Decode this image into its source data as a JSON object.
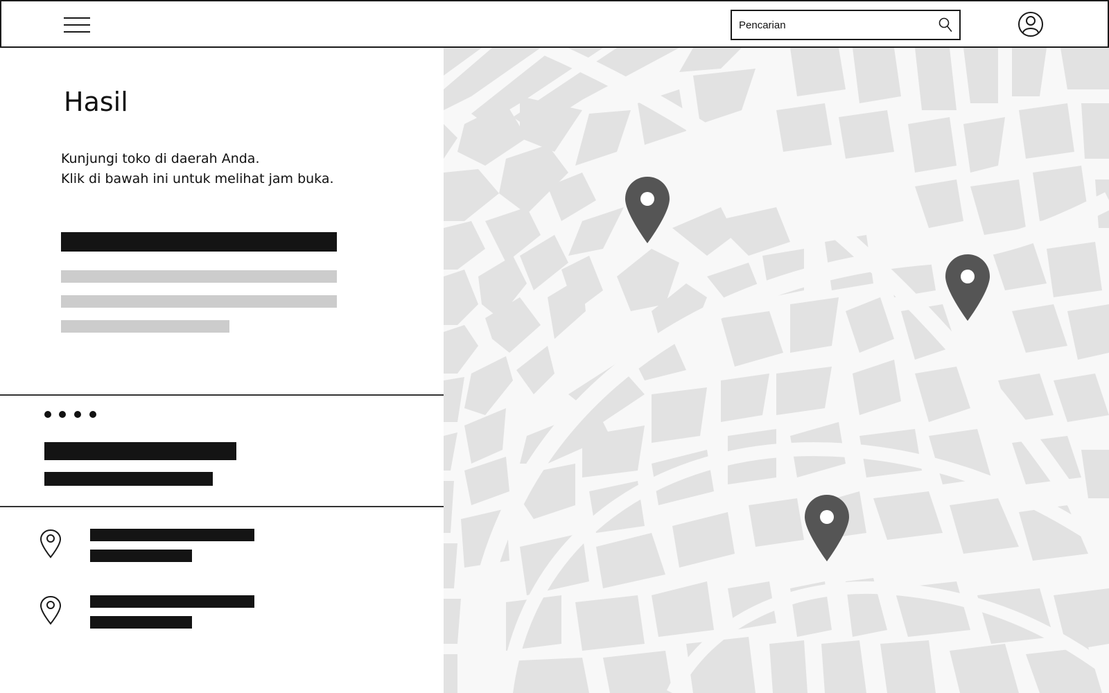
{
  "header": {
    "menu_icon": "hamburger-menu-icon",
    "search": {
      "placeholder": "Pencarian",
      "icon": "search-icon"
    },
    "account_icon": "user-account-icon"
  },
  "results": {
    "title": "Hasil",
    "description_line_1": "Kunjungi toko di daerah Anda.",
    "description_line_2": "Klik di bawah ini untuk melihat jam buka."
  },
  "map": {
    "marker_icon": "location-marker-icon",
    "marker_color": "#555555",
    "block_color": "#e2e2e2",
    "road_color": "#f8f8f8"
  },
  "colors": {
    "text": "#111111",
    "placeholder_bar": "#141414",
    "placeholder_bar_light": "#cccccc",
    "border": "#1a1a1a"
  }
}
